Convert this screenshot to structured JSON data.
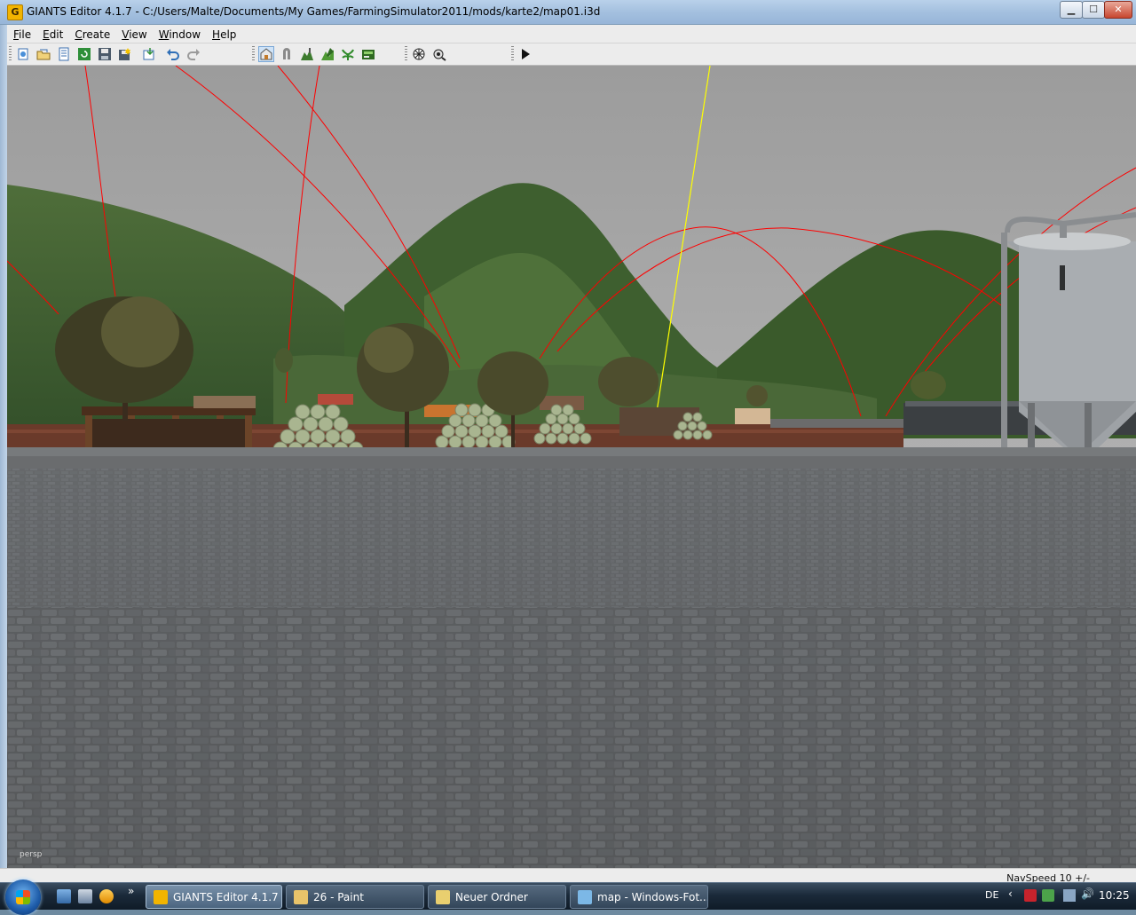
{
  "window": {
    "app_icon_letter": "G",
    "title": "GIANTS Editor 4.1.7 - C:/Users/Malte/Documents/My Games/FarmingSimulator2011/mods/karte2/map01.i3d",
    "minimize_label": "▁",
    "maximize_label": "☐",
    "close_label": "✕"
  },
  "menu": {
    "items": [
      {
        "underline": "F",
        "rest": "ile"
      },
      {
        "underline": "E",
        "rest": "dit"
      },
      {
        "underline": "C",
        "rest": "reate"
      },
      {
        "underline": "V",
        "rest": "iew"
      },
      {
        "underline": "W",
        "rest": "indow"
      },
      {
        "underline": "H",
        "rest": "elp"
      }
    ]
  },
  "toolbar": {
    "file_group": [
      "new-file-icon",
      "open-file-icon",
      "file-list-icon",
      "reload-icon",
      "save-icon",
      "save-all-icon",
      "import-icon",
      "undo-icon",
      "redo-icon"
    ],
    "tool_group": [
      "select-tool-icon",
      "move-tool-icon",
      "terrain-sculpt-icon",
      "terrain-paint-icon",
      "foliage-paint-icon",
      "detail-layer-icon"
    ],
    "render_group": [
      "render-settings-icon",
      "shader-icon"
    ],
    "play_group": [
      "play-icon"
    ],
    "colors": {
      "accent": "#7aa7d6",
      "toolbar_bg": "#ececec"
    }
  },
  "viewport": {
    "camera_label": "persp",
    "sky_color": "#a6a6a6",
    "ground_color": "#5b5d5f",
    "hill_color": "#3f5f2a",
    "spline_color": "#ff0000",
    "gizmo_color": "#ffff00"
  },
  "status": {
    "navspeed": "NavSpeed 10 +/-"
  },
  "taskbar": {
    "start": "start-orb-icon",
    "quick_launch_more": "»",
    "tasks": [
      {
        "label": "GIANTS Editor 4.1.7 ...",
        "icon": "giants-editor-icon",
        "icon_color": "#f2b400",
        "active": true
      },
      {
        "label": "26 - Paint",
        "icon": "paint-icon",
        "icon_color": "#e8c36a",
        "active": false
      },
      {
        "label": "Neuer Ordner",
        "icon": "folder-icon",
        "icon_color": "#e9cf6f",
        "active": false
      },
      {
        "label": "map - Windows-Fot...",
        "icon": "photo-viewer-icon",
        "icon_color": "#7cb8e6",
        "active": false
      }
    ],
    "language": "DE",
    "tray_chevron": "‹",
    "volume_glyph": "🔊",
    "clock": "10:25"
  }
}
